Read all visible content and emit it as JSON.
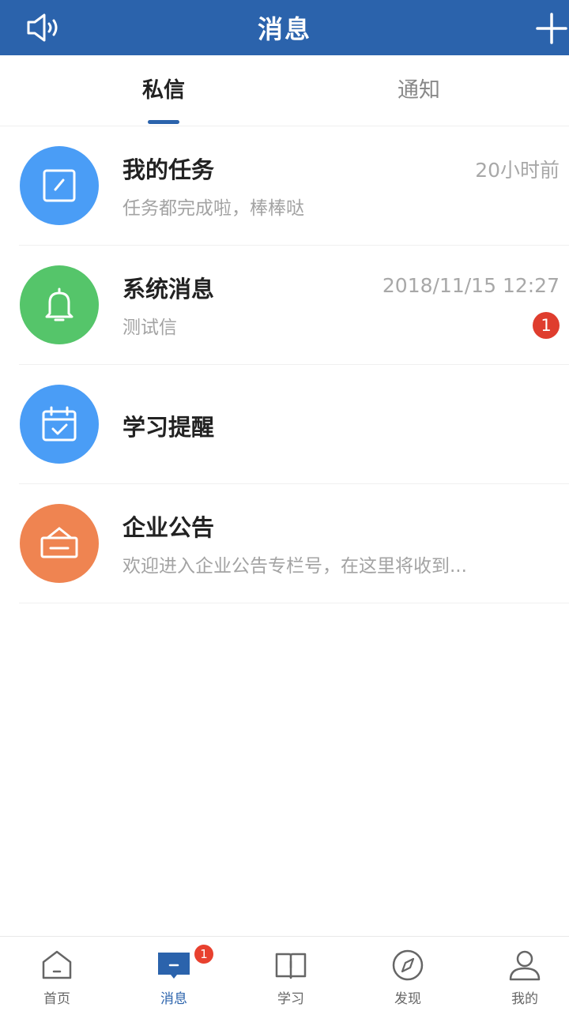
{
  "header": {
    "title": "消息"
  },
  "tabs": [
    {
      "label": "私信",
      "active": true
    },
    {
      "label": "通知",
      "active": false
    }
  ],
  "messages": [
    {
      "name": "我的任务",
      "subtitle": "任务都完成啦，棒棒哒",
      "time": "20小时前",
      "badge": "",
      "icon": "edit-icon",
      "color": "#4a9df6"
    },
    {
      "name": "系统消息",
      "subtitle": "测试信",
      "time": "2018/11/15 12:27",
      "badge": "1",
      "icon": "bell-icon",
      "color": "#55c56a"
    },
    {
      "name": "学习提醒",
      "subtitle": "",
      "time": "",
      "badge": "",
      "icon": "calendar-check-icon",
      "color": "#4a9df6"
    },
    {
      "name": "企业公告",
      "subtitle": "欢迎进入企业公告专栏号，在这里将收到...",
      "time": "",
      "badge": "",
      "icon": "announcement-board-icon",
      "color": "#ef8451"
    }
  ],
  "nav": [
    {
      "label": "首页",
      "icon": "home-icon",
      "active": false
    },
    {
      "label": "消息",
      "icon": "message-icon",
      "active": true,
      "badge": "1"
    },
    {
      "label": "学习",
      "icon": "book-icon",
      "active": false
    },
    {
      "label": "发现",
      "icon": "compass-icon",
      "active": false
    },
    {
      "label": "我的",
      "icon": "user-icon",
      "active": false
    }
  ],
  "colors": {
    "primary": "#2b63ac",
    "badge": "#df3d2e"
  }
}
